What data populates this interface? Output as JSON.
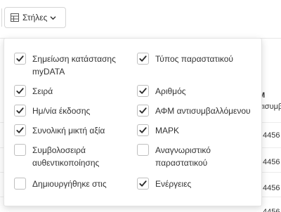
{
  "toolbar": {
    "columns_button": {
      "label": "Στήλες",
      "icon": "columns-icon",
      "caret_icon": "chevron-down-icon"
    }
  },
  "background": {
    "header_title": "Μ",
    "header_subtitle": "αισυμβ",
    "row_values": [
      "4456",
      "4456",
      "4456",
      "4456"
    ]
  },
  "columns_menu": {
    "options": [
      {
        "label": "Σημείωση κατάστασης myDATA",
        "checked": true
      },
      {
        "label": "Τύπος παραστατικού",
        "checked": true
      },
      {
        "label": "Σειρά",
        "checked": true
      },
      {
        "label": "Αριθμός",
        "checked": true
      },
      {
        "label": "Ημ/νία έκδοσης",
        "checked": true
      },
      {
        "label": "ΑΦΜ αντισυμβαλλόμενου",
        "checked": true
      },
      {
        "label": "Συνολική μικτή αξία",
        "checked": true
      },
      {
        "label": "ΜΑΡΚ",
        "checked": true
      },
      {
        "label": "Συμβολοσειρά αυθεντικοποίησης",
        "checked": false
      },
      {
        "label": "Αναγνωριστικό παραστατικού",
        "checked": false
      },
      {
        "label": "Δημιουργήθηκε στις",
        "checked": false
      },
      {
        "label": "Ενέργειες",
        "checked": true
      }
    ]
  }
}
